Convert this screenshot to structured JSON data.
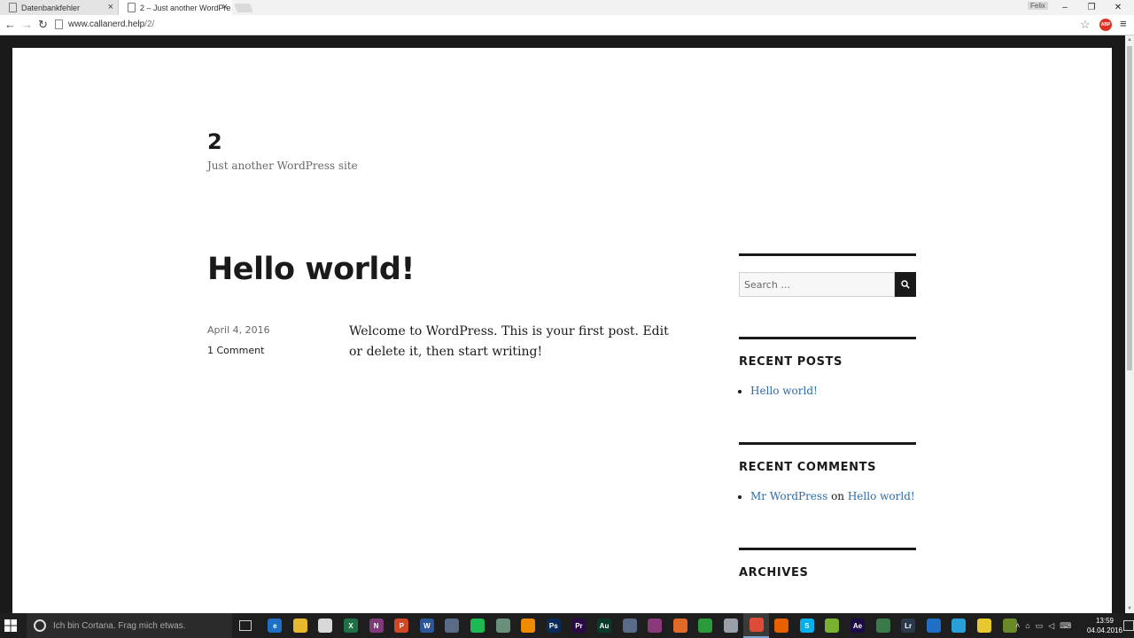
{
  "browser": {
    "tabs": [
      {
        "label": "Datenbankfehler",
        "active": false
      },
      {
        "label": "2 – Just another WordPre",
        "active": true
      }
    ],
    "user_badge": "Felix",
    "window_controls": {
      "minimize": "–",
      "restore": "❐",
      "close": "✕"
    },
    "address": {
      "host": "www.callanerd.help",
      "path": "/2/"
    }
  },
  "site": {
    "title": "2",
    "description": "Just another WordPress site"
  },
  "post": {
    "title": "Hello world!",
    "date": "April 4, 2016",
    "comments_link": "1 Comment",
    "content": "Welcome to WordPress. This is your first post. Edit or delete it, then start writing!"
  },
  "sidebar": {
    "search": {
      "placeholder": "Search …"
    },
    "recent_posts": {
      "title": "RECENT POSTS",
      "items": [
        "Hello world!"
      ]
    },
    "recent_comments": {
      "title": "RECENT COMMENTS",
      "items": [
        {
          "author": "Mr WordPress",
          "connector": "on",
          "post": "Hello world!"
        }
      ]
    },
    "archives": {
      "title": "ARCHIVES"
    }
  },
  "taskbar": {
    "cortana_placeholder": "Ich bin Cortana. Frag mich etwas.",
    "apps": [
      {
        "name": "edge",
        "glyph": "e",
        "color": "#1f6fc5"
      },
      {
        "name": "file-explorer",
        "glyph": "",
        "color": "#e8b730"
      },
      {
        "name": "store",
        "glyph": "",
        "color": "#d8d8d8"
      },
      {
        "name": "excel",
        "glyph": "X",
        "color": "#1e7145"
      },
      {
        "name": "onenote",
        "glyph": "N",
        "color": "#80397b"
      },
      {
        "name": "powerpoint",
        "glyph": "P",
        "color": "#d24726"
      },
      {
        "name": "word",
        "glyph": "W",
        "color": "#2b579a"
      },
      {
        "name": "app-8",
        "glyph": "",
        "color": "#5a6b88"
      },
      {
        "name": "spotify",
        "glyph": "",
        "color": "#1db954"
      },
      {
        "name": "app-10",
        "glyph": "",
        "color": "#6a8f7a"
      },
      {
        "name": "vlc",
        "glyph": "",
        "color": "#f08a00"
      },
      {
        "name": "photoshop",
        "glyph": "Ps",
        "color": "#0a2a5a"
      },
      {
        "name": "premiere",
        "glyph": "Pr",
        "color": "#2a0a45"
      },
      {
        "name": "audition",
        "glyph": "Au",
        "color": "#0a3a2a"
      },
      {
        "name": "app-15",
        "glyph": "",
        "color": "#5a6b88"
      },
      {
        "name": "app-16",
        "glyph": "",
        "color": "#8a3a7a"
      },
      {
        "name": "app-17",
        "glyph": "",
        "color": "#e06a2a"
      },
      {
        "name": "app-18",
        "glyph": "",
        "color": "#2a9a3a"
      },
      {
        "name": "app-19",
        "glyph": "",
        "color": "#9aa0a8"
      },
      {
        "name": "chrome",
        "glyph": "",
        "color": "#dd4b39"
      },
      {
        "name": "firefox",
        "glyph": "",
        "color": "#e66000"
      },
      {
        "name": "skype",
        "glyph": "S",
        "color": "#00aff0"
      },
      {
        "name": "app-23",
        "glyph": "",
        "color": "#7ab030"
      },
      {
        "name": "after-effects",
        "glyph": "Ae",
        "color": "#1a0a45"
      },
      {
        "name": "app-25",
        "glyph": "",
        "color": "#3a7a4a"
      },
      {
        "name": "lightroom",
        "glyph": "Lr",
        "color": "#2a3a4a"
      },
      {
        "name": "app-27",
        "glyph": "",
        "color": "#1f6fc5"
      },
      {
        "name": "app-28",
        "glyph": "",
        "color": "#2aa0d8"
      },
      {
        "name": "app-29",
        "glyph": "",
        "color": "#e8c830"
      },
      {
        "name": "app-30",
        "glyph": "",
        "color": "#6a8a2a"
      }
    ],
    "active_app": "chrome",
    "clock": {
      "time": "13:59",
      "date": "04.04.2016"
    }
  }
}
